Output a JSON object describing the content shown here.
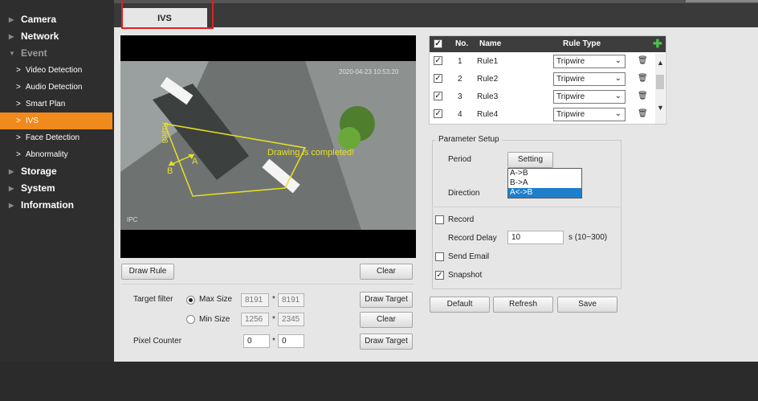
{
  "sidebar": {
    "items": [
      {
        "label": "Camera",
        "level": "top"
      },
      {
        "label": "Network",
        "level": "top"
      },
      {
        "label": "Event",
        "level": "top-open"
      },
      {
        "label": "Video Detection",
        "level": "sub"
      },
      {
        "label": "Audio Detection",
        "level": "sub"
      },
      {
        "label": "Smart Plan",
        "level": "sub"
      },
      {
        "label": "IVS",
        "level": "sub-active"
      },
      {
        "label": "Face Detection",
        "level": "sub"
      },
      {
        "label": "Abnormality",
        "level": "sub"
      },
      {
        "label": "Storage",
        "level": "top"
      },
      {
        "label": "System",
        "level": "top"
      },
      {
        "label": "Information",
        "level": "top"
      }
    ]
  },
  "tab": {
    "label": "IVS"
  },
  "video": {
    "timestamp": "2020-04-23 10:53:20",
    "rule_label": "Rule8",
    "point_a": "A",
    "point_b": "B",
    "status_text": "Drawing is completed!",
    "corner_label": "IPC"
  },
  "controls": {
    "draw_rule": "Draw Rule",
    "clear_top": "Clear",
    "target_filter_label": "Target filter",
    "max_size_label": "Max Size",
    "max_w": "8191",
    "max_h": "8191",
    "min_size_label": "Min Size",
    "min_w": "1256",
    "min_h": "2345",
    "times": "*",
    "draw_target_1": "Draw Target",
    "clear_2": "Clear",
    "pixel_counter_label": "Pixel Counter",
    "pix_w": "0",
    "pix_h": "0",
    "draw_target_2": "Draw Target"
  },
  "rules_table": {
    "headers": {
      "no": "No.",
      "name": "Name",
      "type": "Rule Type"
    },
    "rows": [
      {
        "no": "1",
        "name": "Rule1",
        "type": "Tripwire",
        "checked": true
      },
      {
        "no": "2",
        "name": "Rule2",
        "type": "Tripwire",
        "checked": true
      },
      {
        "no": "3",
        "name": "Rule3",
        "type": "Tripwire",
        "checked": true
      },
      {
        "no": "4",
        "name": "Rule4",
        "type": "Tripwire",
        "checked": true
      }
    ]
  },
  "params": {
    "legend": "Parameter Setup",
    "period_label": "Period",
    "setting_button": "Setting",
    "direction_label": "Direction",
    "direction_options": [
      "A->B",
      "B->A",
      "A<->B"
    ],
    "direction_selected": "A<->B",
    "record_label": "Record",
    "record_checked": false,
    "record_delay_label": "Record Delay",
    "record_delay_value": "10",
    "record_delay_unit": "s (10~300)",
    "send_email_label": "Send Email",
    "send_email_checked": false,
    "snapshot_label": "Snapshot",
    "snapshot_checked": true
  },
  "footer_buttons": {
    "default": "Default",
    "refresh": "Refresh",
    "save": "Save"
  },
  "colors": {
    "accent": "#f08a1d",
    "rule_line": "#e8e020",
    "selected": "#1e7fcb",
    "highlight": "#e02020"
  }
}
